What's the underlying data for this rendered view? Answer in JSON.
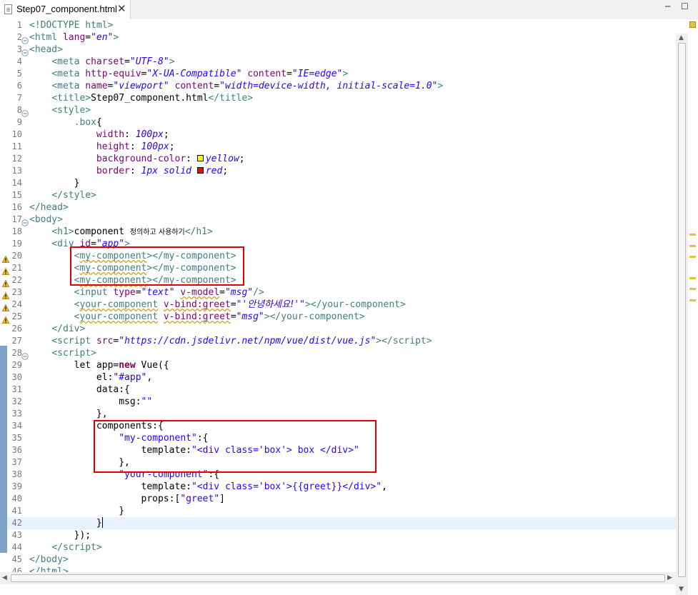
{
  "tab": {
    "title": "Step07_component.html",
    "close": "✕"
  },
  "window": {
    "minimize": "─",
    "maximize": "☐"
  },
  "code_lines": [
    {
      "n": "1",
      "fold": false,
      "warn": false,
      "html": "<span class=\"t\">&lt;!DOCTYPE html&gt;</span>"
    },
    {
      "n": "2",
      "fold": true,
      "warn": false,
      "html": "<span class=\"t\">&lt;html</span> <span class=\"a\">lang</span>=<span class=\"v\">\"en\"</span><span class=\"t\">&gt;</span>"
    },
    {
      "n": "3",
      "fold": true,
      "warn": false,
      "html": "<span class=\"t\">&lt;head&gt;</span>"
    },
    {
      "n": "4",
      "fold": false,
      "warn": false,
      "html": "    <span class=\"t\">&lt;meta</span> <span class=\"a\">charset</span>=<span class=\"v\">\"UTF-8\"</span><span class=\"t\">&gt;</span>"
    },
    {
      "n": "5",
      "fold": false,
      "warn": false,
      "html": "    <span class=\"t\">&lt;meta</span> <span class=\"a\">http-equiv</span>=<span class=\"v\">\"X-UA-Compatible\"</span> <span class=\"a\">content</span>=<span class=\"v\">\"IE=edge\"</span><span class=\"t\">&gt;</span>"
    },
    {
      "n": "6",
      "fold": false,
      "warn": false,
      "html": "    <span class=\"t\">&lt;meta</span> <span class=\"a\">name</span>=<span class=\"v\">\"viewport\"</span> <span class=\"a\">content</span>=<span class=\"v\">\"width=device-width, initial-scale=1.0\"</span><span class=\"t\">&gt;</span>"
    },
    {
      "n": "7",
      "fold": false,
      "warn": false,
      "html": "    <span class=\"t\">&lt;title&gt;</span>Step07_component.html<span class=\"t\">&lt;/title&gt;</span>"
    },
    {
      "n": "8",
      "fold": true,
      "warn": false,
      "html": "    <span class=\"t\">&lt;style&gt;</span>"
    },
    {
      "n": "9",
      "fold": false,
      "warn": false,
      "html": "        <span class=\"t\">.box</span>{"
    },
    {
      "n": "10",
      "fold": false,
      "warn": false,
      "html": "            <span class=\"a\">width</span>: <span class=\"cv\">100px</span>;"
    },
    {
      "n": "11",
      "fold": false,
      "warn": false,
      "html": "            <span class=\"a\">height</span>: <span class=\"cv\">100px</span>;"
    },
    {
      "n": "12",
      "fold": false,
      "warn": false,
      "html": "            <span class=\"a\">background-color</span>: <span class=\"swatch\" style=\"background:#ffff00\"></span><span class=\"cv\">yellow</span>;"
    },
    {
      "n": "13",
      "fold": false,
      "warn": false,
      "html": "            <span class=\"a\">border</span>: <span class=\"cv\">1px solid</span> <span class=\"swatch\" style=\"background:#ff0000\"></span><span class=\"cv\">red</span>;"
    },
    {
      "n": "14",
      "fold": false,
      "warn": false,
      "html": "        }"
    },
    {
      "n": "15",
      "fold": false,
      "warn": false,
      "html": "    <span class=\"t\">&lt;/style&gt;</span>"
    },
    {
      "n": "16",
      "fold": false,
      "warn": false,
      "html": "<span class=\"t\">&lt;/head&gt;</span>"
    },
    {
      "n": "17",
      "fold": true,
      "warn": false,
      "html": "<span class=\"t\">&lt;body&gt;</span>"
    },
    {
      "n": "18",
      "fold": false,
      "warn": false,
      "html": "    <span class=\"t\">&lt;h1&gt;</span>component <span style=\"font-family:'DejaVu Sans',sans-serif;font-size:10px\">정의하고 사용하기</span><span class=\"t\">&lt;/h1&gt;</span>"
    },
    {
      "n": "19",
      "fold": false,
      "warn": false,
      "html": "    <span class=\"t\">&lt;div</span> <span class=\"a\">id</span>=<span class=\"v\">\"app\"</span><span class=\"t\">&gt;</span>"
    },
    {
      "n": "20",
      "fold": false,
      "warn": true,
      "html": "        <span class=\"t\">&lt;<span class=\"warn\">my-component</span>&gt;&lt;/my-component&gt;</span>"
    },
    {
      "n": "21",
      "fold": false,
      "warn": true,
      "html": "        <span class=\"t\">&lt;<span class=\"warn\">my-component</span>&gt;&lt;/my-component&gt;</span>"
    },
    {
      "n": "22",
      "fold": false,
      "warn": true,
      "html": "        <span class=\"t\">&lt;<span class=\"warn\">my-component</span>&gt;&lt;/my-component&gt;</span>"
    },
    {
      "n": "23",
      "fold": false,
      "warn": true,
      "html": "        <span class=\"t\">&lt;input</span> <span class=\"a\">type</span>=<span class=\"v\">\"text\"</span> <span class=\"a warn\">v-model</span>=<span class=\"v\">\"msg\"</span><span class=\"t\">/&gt;</span>"
    },
    {
      "n": "24",
      "fold": false,
      "warn": true,
      "html": "        <span class=\"t\">&lt;<span class=\"warn\">your-component</span></span> <span class=\"a warn\">v-bind:greet</span>=<span class=\"v\">\"'<span style=\"font-family:'DejaVu Sans',sans-serif\">안녕하세요!</span>'\"</span><span class=\"t\">&gt;&lt;/your-component&gt;</span>"
    },
    {
      "n": "25",
      "fold": false,
      "warn": true,
      "html": "        <span class=\"t\">&lt;<span class=\"warn\">your-component</span></span> <span class=\"a warn\">v-bind:greet</span>=<span class=\"v\">\"msg\"</span><span class=\"t\">&gt;&lt;/your-component&gt;</span>"
    },
    {
      "n": "26",
      "fold": false,
      "warn": false,
      "html": "    <span class=\"t\">&lt;/div&gt;</span>"
    },
    {
      "n": "27",
      "fold": false,
      "warn": false,
      "html": "    <span class=\"t\">&lt;script</span> <span class=\"a\">src</span>=<span class=\"v\">\"https://cdn.jsdelivr.net/npm/vue/dist/vue.js\"</span><span class=\"t\">&gt;&lt;/script&gt;</span>"
    },
    {
      "n": "28",
      "fold": true,
      "warn": false,
      "html": "    <span class=\"t\">&lt;script&gt;</span>"
    },
    {
      "n": "29",
      "fold": false,
      "warn": false,
      "html": "        let app=<span class=\"k\">new</span> Vue({"
    },
    {
      "n": "30",
      "fold": false,
      "warn": false,
      "html": "            el:<span class=\"s\">\"#app\"</span>,"
    },
    {
      "n": "31",
      "fold": false,
      "warn": false,
      "html": "            data:{"
    },
    {
      "n": "32",
      "fold": false,
      "warn": false,
      "html": "                msg:<span class=\"s\">\"\"</span>"
    },
    {
      "n": "33",
      "fold": false,
      "warn": false,
      "html": "            },"
    },
    {
      "n": "34",
      "fold": false,
      "warn": false,
      "html": "            components:{"
    },
    {
      "n": "35",
      "fold": false,
      "warn": false,
      "html": "                <span class=\"s\">\"my-component\"</span>:{"
    },
    {
      "n": "36",
      "fold": false,
      "warn": false,
      "html": "                    template:<span class=\"s\">\"&lt;div class='box'&gt; box &lt;/div&gt;\"</span>"
    },
    {
      "n": "37",
      "fold": false,
      "warn": false,
      "html": "                },"
    },
    {
      "n": "38",
      "fold": false,
      "warn": false,
      "html": "                <span class=\"s\">\"your-component\"</span>:{"
    },
    {
      "n": "39",
      "fold": false,
      "warn": false,
      "html": "                    template:<span class=\"s\">\"&lt;div class='box'&gt;{{greet}}&lt;/div&gt;\"</span>,"
    },
    {
      "n": "40",
      "fold": false,
      "warn": false,
      "html": "                    props:[<span class=\"s\">\"greet\"</span>]"
    },
    {
      "n": "41",
      "fold": false,
      "warn": false,
      "html": "                }"
    },
    {
      "n": "42",
      "fold": false,
      "warn": false,
      "html": "            }<span class=\"cursor\"></span>",
      "current": true
    },
    {
      "n": "43",
      "fold": false,
      "warn": false,
      "html": "        });"
    },
    {
      "n": "44",
      "fold": false,
      "warn": false,
      "html": "    <span class=\"t\">&lt;/script&gt;</span>"
    },
    {
      "n": "45",
      "fold": false,
      "warn": false,
      "html": "<span class=\"t\">&lt;/body&gt;</span>"
    },
    {
      "n": "46",
      "fold": false,
      "warn": false,
      "html": "<span class=\"t\">&lt;/html&gt;</span>"
    }
  ],
  "colors": {
    "tag": "#3f7f7f",
    "attr": "#7f007f",
    "value": "#2a00ff",
    "keyword": "#7f0055",
    "highlight_box": "#e00000",
    "warning": "#e8c040"
  }
}
